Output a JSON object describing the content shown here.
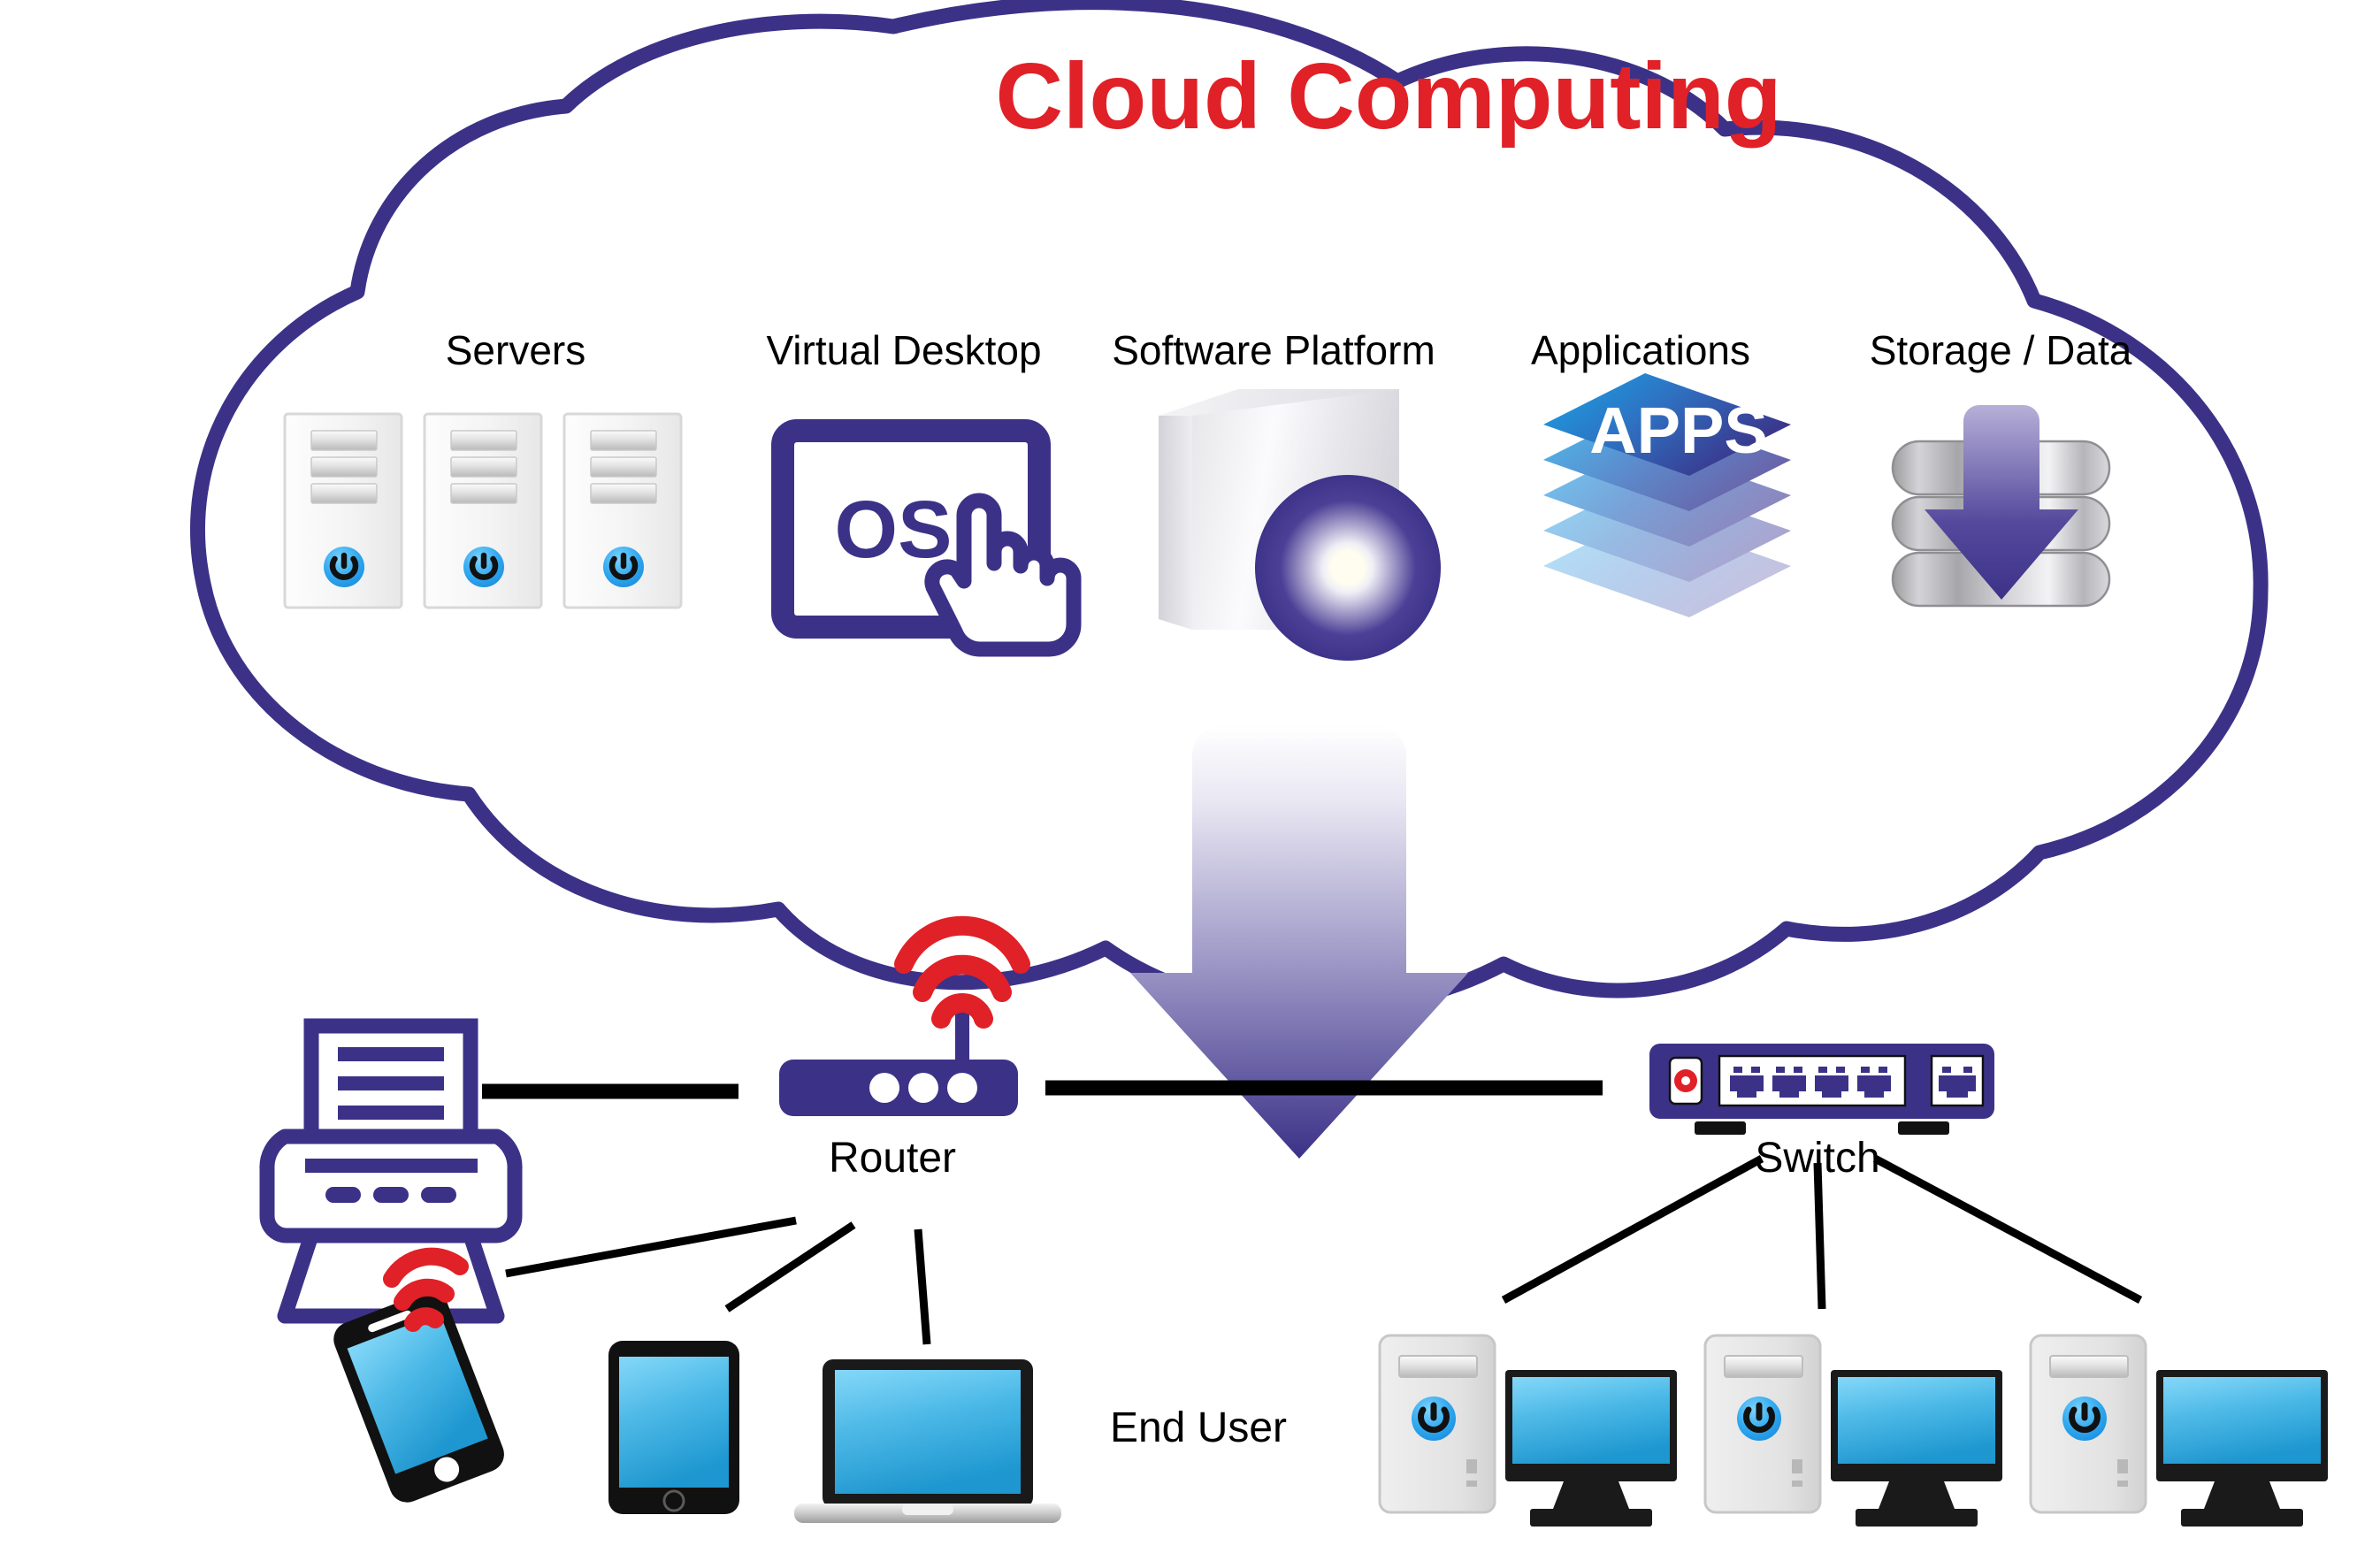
{
  "diagram": {
    "title": "Cloud Computing",
    "title_color": "#e02127",
    "cloud_stroke_color": "#3b3288",
    "background_color": "#ffffff"
  },
  "cloud": {
    "services": [
      {
        "label": "Servers",
        "icon": "server-tower-icon",
        "count": 3
      },
      {
        "label": "Virtual Desktop",
        "icon": "os-screen-touch-icon",
        "screen_text": "OS"
      },
      {
        "label": "Software Platform",
        "icon": "software-box-disc-icon"
      },
      {
        "label": "Applications",
        "icon": "apps-layer-stack-icon",
        "stack_text": "APPS"
      },
      {
        "label": "Storage / Data",
        "icon": "database-download-icon"
      }
    ]
  },
  "flow": {
    "arrow": "download-arrow-icon",
    "direction": "down",
    "gradient_from": "#ffffff",
    "gradient_to": "#3b3288"
  },
  "network": {
    "nodes": [
      {
        "label": "Router",
        "icon": "wifi-router-icon",
        "wifi": true,
        "wifi_color": "#e02127",
        "body_color": "#3b3288",
        "leds": 3
      },
      {
        "label": "Switch",
        "icon": "network-switch-icon",
        "body_color": "#3b3288",
        "power_led_color": "#e02127",
        "ports": 5
      },
      {
        "label": "End User",
        "icon": "end-user-label"
      }
    ],
    "clients_left": [
      {
        "name": "Printer",
        "icon": "printer-icon",
        "color": "#3b3288"
      },
      {
        "name": "Smartphone",
        "icon": "smartphone-icon",
        "wifi": true,
        "screen_color": "#29abe2"
      },
      {
        "name": "Tablet",
        "icon": "tablet-icon",
        "screen_color": "#29abe2"
      },
      {
        "name": "Laptop",
        "icon": "laptop-icon",
        "screen_color": "#29abe2"
      }
    ],
    "clients_right": [
      {
        "name": "Desktop Computer 1",
        "icon": "desktop-computer-icon",
        "screen_color": "#29abe2"
      },
      {
        "name": "Desktop Computer 2",
        "icon": "desktop-computer-icon",
        "screen_color": "#29abe2"
      },
      {
        "name": "Desktop Computer 3",
        "icon": "desktop-computer-icon",
        "screen_color": "#29abe2"
      }
    ]
  }
}
